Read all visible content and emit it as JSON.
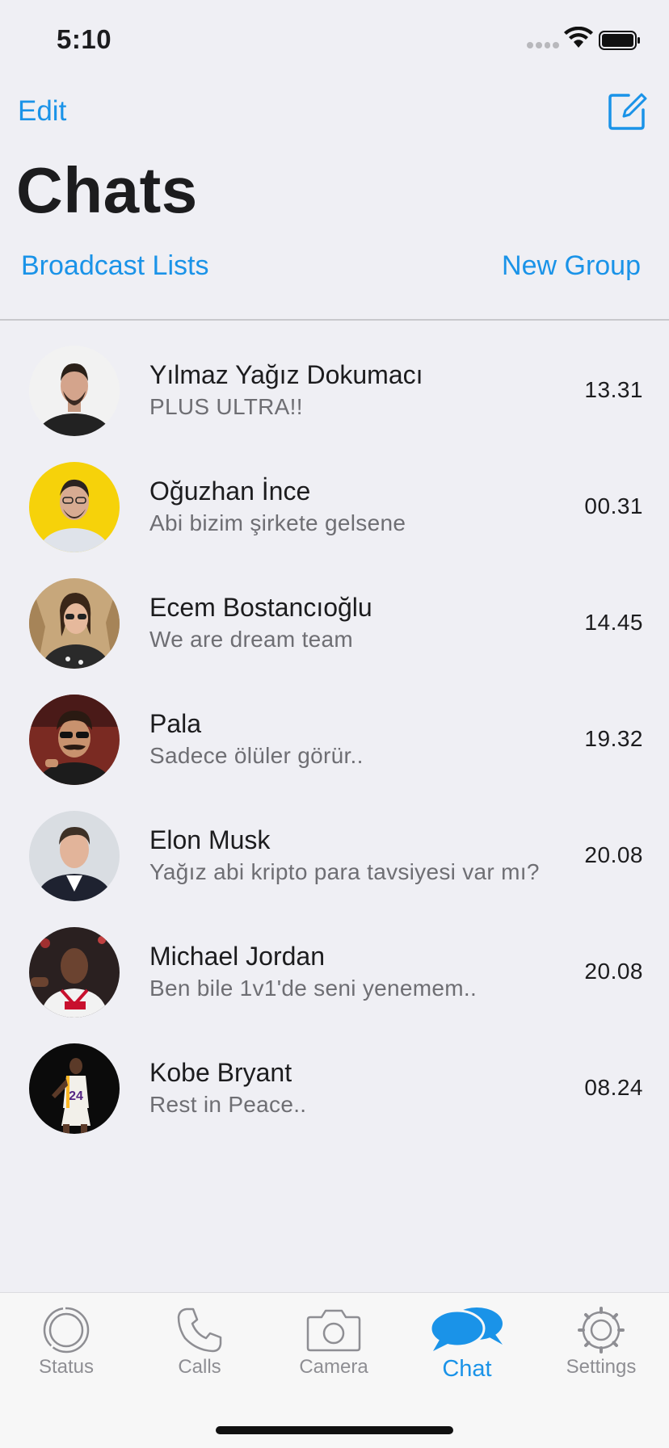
{
  "status_bar": {
    "time": "5:10"
  },
  "header": {
    "edit_label": "Edit",
    "title": "Chats",
    "broadcast_label": "Broadcast Lists",
    "new_group_label": "New Group"
  },
  "chats": [
    {
      "name": "Yılmaz Yağız Dokumacı",
      "message": "PLUS ULTRA!!",
      "time": "13.31"
    },
    {
      "name": "Oğuzhan İnce",
      "message": "Abi bizim şirkete gelsene",
      "time": "00.31"
    },
    {
      "name": "Ecem Bostancıoğlu",
      "message": "We are dream team",
      "time": "14.45"
    },
    {
      "name": "Pala",
      "message": "Sadece ölüler görür..",
      "time": "19.32"
    },
    {
      "name": "Elon Musk",
      "message": "Yağız abi kripto para tavsiyesi var mı?",
      "time": "20.08"
    },
    {
      "name": "Michael Jordan",
      "message": "Ben bile 1v1'de seni yenemem..",
      "time": "20.08"
    },
    {
      "name": "Kobe Bryant",
      "message": "Rest in Peace..",
      "time": "08.24"
    }
  ],
  "tab_bar": {
    "tabs": [
      {
        "label": "Status",
        "icon": "status-icon"
      },
      {
        "label": "Calls",
        "icon": "phone-icon"
      },
      {
        "label": "Camera",
        "icon": "camera-icon"
      },
      {
        "label": "Chat",
        "icon": "chat-bubbles-icon",
        "active": true
      },
      {
        "label": "Settings",
        "icon": "gear-icon"
      }
    ]
  },
  "colors": {
    "accent": "#1a93e8",
    "background": "#efeff4",
    "secondary_text": "#6e6e73"
  }
}
